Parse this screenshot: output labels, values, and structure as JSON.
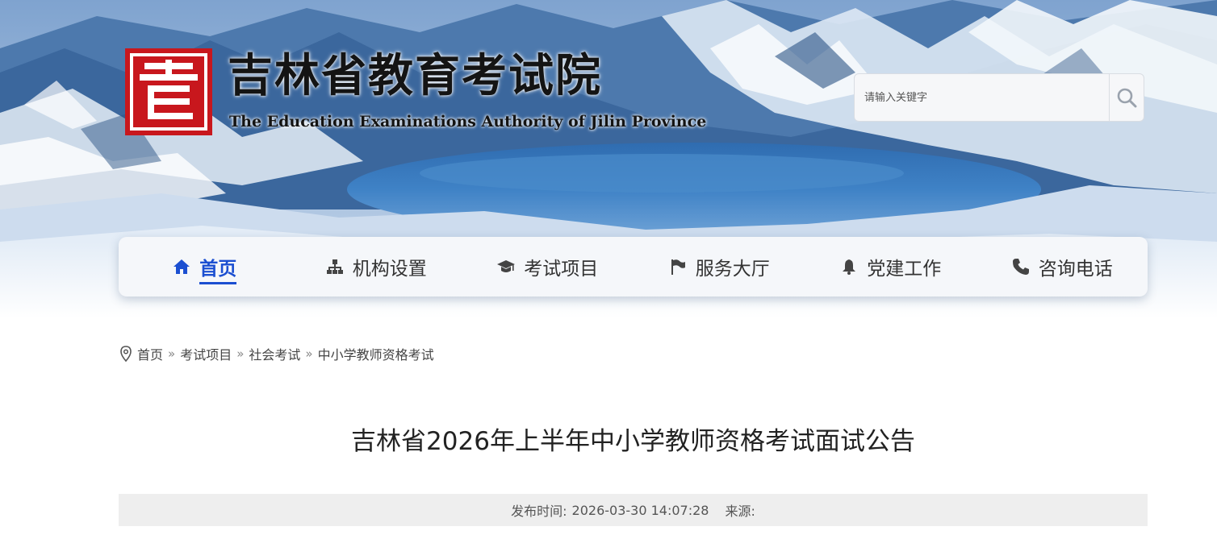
{
  "header": {
    "title": "吉林省教育考试院",
    "subtitle": "The Education Examinations Authority of Jilin Province",
    "logo_icon": "seal-logo-icon",
    "brand_red": "#c8171d"
  },
  "search": {
    "placeholder": "请输入关键字",
    "icon": "search-icon"
  },
  "nav": {
    "accent": "#1b4fd1",
    "items": [
      {
        "label": "首页",
        "icon": "home-icon",
        "active": true
      },
      {
        "label": "机构设置",
        "icon": "org-chart-icon",
        "active": false
      },
      {
        "label": "考试项目",
        "icon": "graduation-cap-icon",
        "active": false
      },
      {
        "label": "服务大厅",
        "icon": "flag-icon",
        "active": false
      },
      {
        "label": "党建工作",
        "icon": "bell-icon",
        "active": false
      },
      {
        "label": "咨询电话",
        "icon": "phone-icon",
        "active": false
      }
    ]
  },
  "breadcrumb": {
    "icon": "location-pin-icon",
    "items": [
      "首页",
      "考试项目",
      "社会考试",
      "中小学教师资格考试"
    ],
    "separator": "»"
  },
  "article": {
    "title": "吉林省2026年上半年中小学教师资格考试面试公告",
    "publish_label": "发布时间:",
    "publish_time": "2026-03-30 14:07:28",
    "source_label": "来源:"
  }
}
